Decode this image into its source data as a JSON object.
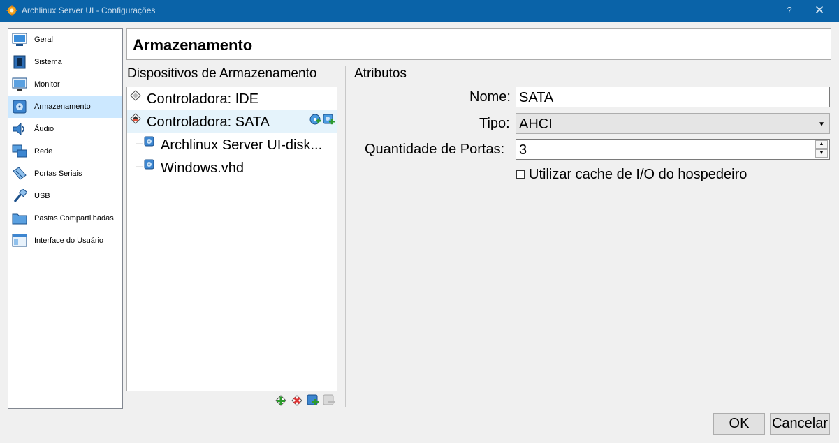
{
  "window": {
    "title": "Archlinux Server UI - Configurações",
    "help_glyph": "?",
    "close_glyph": "✕"
  },
  "sidebar": {
    "items": [
      {
        "label": "Geral",
        "icon": "general-icon"
      },
      {
        "label": "Sistema",
        "icon": "system-icon"
      },
      {
        "label": "Monitor",
        "icon": "monitor-icon"
      },
      {
        "label": "Armazenamento",
        "icon": "storage-icon",
        "selected": true
      },
      {
        "label": "Áudio",
        "icon": "audio-icon"
      },
      {
        "label": "Rede",
        "icon": "network-icon"
      },
      {
        "label": "Portas Seriais",
        "icon": "serial-ports-icon"
      },
      {
        "label": "USB",
        "icon": "usb-icon"
      },
      {
        "label": "Pastas Compartilhadas",
        "icon": "shared-folders-icon"
      },
      {
        "label": "Interface do Usuário",
        "icon": "user-interface-icon"
      }
    ]
  },
  "page": {
    "title": "Armazenamento"
  },
  "storage": {
    "heading": "Dispositivos de Armazenamento",
    "tree": [
      {
        "label": "Controladora: IDE",
        "type": "controller"
      },
      {
        "label": "Controladora: SATA",
        "type": "controller",
        "selected": true
      },
      {
        "label": "Archlinux Server UI-disk...",
        "type": "disk"
      },
      {
        "label": "Windows.vhd",
        "type": "disk"
      }
    ],
    "toolbar": [
      "add-controller-icon",
      "remove-controller-icon",
      "add-attachment-icon",
      "remove-attachment-icon"
    ]
  },
  "attributes": {
    "heading": "Atributos",
    "name_label": "Nome:",
    "name_value": "SATA",
    "type_label": "Tipo:",
    "type_value": "AHCI",
    "ports_label": "Quantidade de Portas:",
    "ports_value": "3",
    "cache_label": "Utilizar cache de I/O do hospedeiro",
    "cache_checked": false
  },
  "buttons": {
    "ok": "OK",
    "cancel": "Cancelar"
  },
  "colors": {
    "titlebar": "#0a63a8",
    "selection": "#cce8ff"
  }
}
